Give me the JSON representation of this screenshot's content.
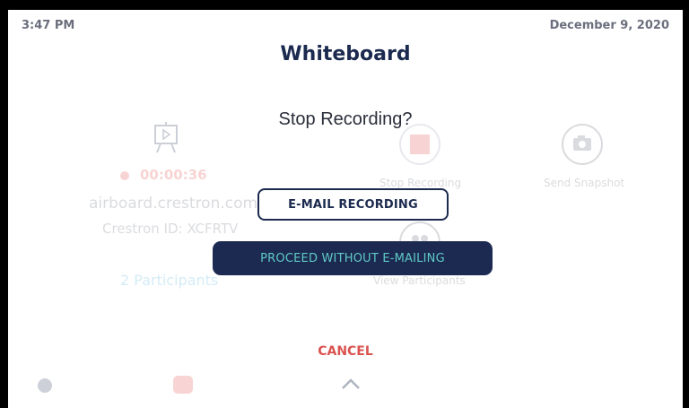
{
  "status": {
    "time": "3:47 PM",
    "date": "December 9, 2020"
  },
  "page": {
    "title": "Whiteboard"
  },
  "background": {
    "recording_timer": "00:00:36",
    "airboard_url": "airboard.crestron.com",
    "crestron_id": "Crestron ID: XCFRTV",
    "participants": "2 Participants",
    "stop_recording_label": "Stop Recording",
    "send_snapshot_label": "Send Snapshot",
    "view_participants_label": "View Participants"
  },
  "dialog": {
    "title": "Stop Recording?",
    "email_button": "E-MAIL RECORDING",
    "proceed_button": "PROCEED WITHOUT E-MAILING",
    "cancel_button": "CANCEL"
  },
  "colors": {
    "accent_navy": "#1c2a52",
    "accent_teal": "#5fc9c4",
    "recording_red": "#e23b3b",
    "cancel_red": "#d9534f"
  },
  "icons": [
    "whiteboard-icon",
    "stop-recording-icon",
    "camera-icon",
    "participants-icon",
    "info-icon",
    "chevron-up-icon"
  ]
}
